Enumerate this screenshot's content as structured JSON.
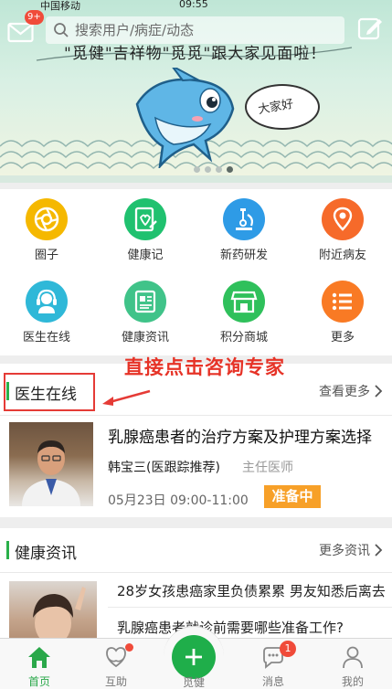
{
  "status_bar": {
    "carrier": "中国移动",
    "time": "09:55"
  },
  "header": {
    "message_badge": "9+",
    "search_placeholder": "搜索用户/病症/动态"
  },
  "banner": {
    "slogan": "\"觅健\"吉祥物\"觅觅\"跟大家见面啦！",
    "bubble_text": "大家好",
    "page_count": 4,
    "active_page": 4
  },
  "grid": {
    "items": [
      {
        "label": "圈子",
        "icon": "aperture-icon",
        "color": "#f5b800"
      },
      {
        "label": "健康记",
        "icon": "health-notebook-icon",
        "color": "#20c16f"
      },
      {
        "label": "新药研发",
        "icon": "microscope-icon",
        "color": "#2e9be6"
      },
      {
        "label": "附近病友",
        "icon": "location-pin-icon",
        "color": "#f66a2a"
      },
      {
        "label": "医生在线",
        "icon": "doctor-headset-icon",
        "color": "#2fb8d8"
      },
      {
        "label": "健康资讯",
        "icon": "newspaper-icon",
        "color": "#40c389"
      },
      {
        "label": "积分商城",
        "icon": "store-icon",
        "color": "#2fc05b"
      },
      {
        "label": "更多",
        "icon": "list-icon",
        "color": "#f97a24"
      }
    ]
  },
  "doctor_section": {
    "title": "医生在线",
    "more": "查看更多",
    "annotation": "直接点击咨询专家",
    "topic": "乳腺癌患者的治疗方案及护理方案选择",
    "doctor_name": "韩宝三(医跟踪推荐)",
    "doctor_title": "主任医师",
    "time": "05月23日 09:00-11:00",
    "status": "准备中",
    "accent": "#2ab04a",
    "status_color": "#f7a028"
  },
  "news_section": {
    "title": "健康资讯",
    "more": "更多资讯",
    "items": [
      "28岁女孩患癌家里负债累累 男友知悉后离去",
      "乳腺癌患者就诊前需要哪些准备工作?"
    ]
  },
  "tabbar": {
    "tabs": [
      {
        "label": "首页",
        "icon": "home-icon",
        "active": true
      },
      {
        "label": "互助",
        "icon": "mutual-aid-icon",
        "dot": true
      },
      {
        "label": "觅健",
        "icon": "plus-icon"
      },
      {
        "label": "消息",
        "icon": "chat-bubble-icon",
        "badge": "1"
      },
      {
        "label": "我的",
        "icon": "person-icon"
      }
    ],
    "active_color": "#2aa84a"
  }
}
